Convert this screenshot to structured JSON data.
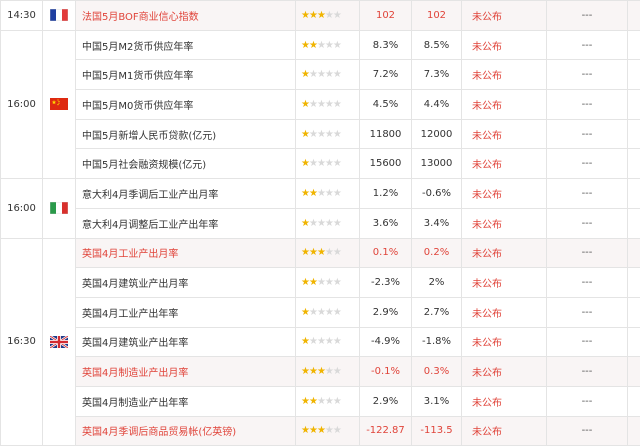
{
  "colors": {
    "accent_red": "#e0443a",
    "star_on": "#f0b400",
    "star_off": "#d9d9d9",
    "chart_blue": "#4a86d8",
    "highlight_bg": "#f9f5f5"
  },
  "groups": [
    {
      "time": "14:30",
      "flag": "france-flag",
      "rows": [
        {
          "event": "法国5月BOF商业信心指数",
          "stars": 3,
          "previous": "102",
          "forecast": "102",
          "actual": "未公布",
          "affect": "---",
          "highlight": true
        }
      ]
    },
    {
      "time": "16:00",
      "flag": "china-flag",
      "rows": [
        {
          "event": "中国5月M2货币供应年率",
          "stars": 2,
          "previous": "8.3%",
          "forecast": "8.5%",
          "actual": "未公布",
          "affect": "---",
          "highlight": false
        },
        {
          "event": "中国5月M1货币供应年率",
          "stars": 1,
          "previous": "7.2%",
          "forecast": "7.3%",
          "actual": "未公布",
          "affect": "---",
          "highlight": false
        },
        {
          "event": "中国5月M0货币供应年率",
          "stars": 1,
          "previous": "4.5%",
          "forecast": "4.4%",
          "actual": "未公布",
          "affect": "---",
          "highlight": false
        },
        {
          "event": "中国5月新增人民币贷款(亿元)",
          "stars": 1,
          "previous": "11800",
          "forecast": "12000",
          "actual": "未公布",
          "affect": "---",
          "highlight": false
        },
        {
          "event": "中国5月社会融资规模(亿元)",
          "stars": 1,
          "previous": "15600",
          "forecast": "13000",
          "actual": "未公布",
          "affect": "---",
          "highlight": false
        }
      ]
    },
    {
      "time": "16:00",
      "flag": "italy-flag",
      "rows": [
        {
          "event": "意大利4月季调后工业产出月率",
          "stars": 2,
          "previous": "1.2%",
          "forecast": "-0.6%",
          "actual": "未公布",
          "affect": "---",
          "highlight": false
        },
        {
          "event": "意大利4月调整后工业产出年率",
          "stars": 1,
          "previous": "3.6%",
          "forecast": "3.4%",
          "actual": "未公布",
          "affect": "---",
          "highlight": false
        }
      ]
    },
    {
      "time": "16:30",
      "flag": "uk-flag",
      "rows": [
        {
          "event": "英国4月工业产出月率",
          "stars": 3,
          "previous": "0.1%",
          "forecast": "0.2%",
          "actual": "未公布",
          "affect": "---",
          "highlight": true
        },
        {
          "event": "英国4月建筑业产出月率",
          "stars": 2,
          "previous": "-2.3%",
          "forecast": "2%",
          "actual": "未公布",
          "affect": "---",
          "highlight": false
        },
        {
          "event": "英国4月工业产出年率",
          "stars": 1,
          "previous": "2.9%",
          "forecast": "2.7%",
          "actual": "未公布",
          "affect": "---",
          "highlight": false
        },
        {
          "event": "英国4月建筑业产出年率",
          "stars": 1,
          "previous": "-4.9%",
          "forecast": "-1.8%",
          "actual": "未公布",
          "affect": "---",
          "highlight": false
        },
        {
          "event": "英国4月制造业产出月率",
          "stars": 3,
          "previous": "-0.1%",
          "forecast": "0.3%",
          "actual": "未公布",
          "affect": "---",
          "highlight": true
        },
        {
          "event": "英国4月制造业产出年率",
          "stars": 2,
          "previous": "2.9%",
          "forecast": "3.1%",
          "actual": "未公布",
          "affect": "---",
          "highlight": false
        },
        {
          "event": "英国4月季调后商品贸易帐(亿英镑)",
          "stars": 3,
          "previous": "-122.87",
          "forecast": "-113.5",
          "actual": "未公布",
          "affect": "---",
          "highlight": true
        }
      ]
    }
  ]
}
